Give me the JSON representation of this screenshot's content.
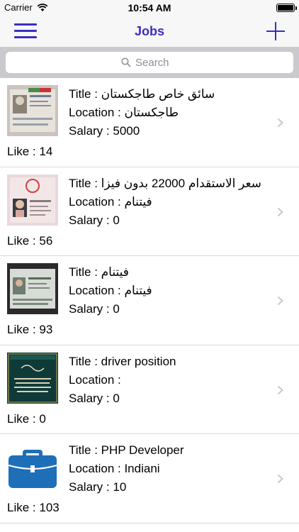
{
  "status": {
    "carrier": "Carrier",
    "time": "10:54 AM"
  },
  "nav": {
    "title": "Jobs"
  },
  "search": {
    "placeholder": "Search"
  },
  "labels": {
    "title_prefix": "Title : ",
    "location_prefix": "Location : ",
    "salary_prefix": "Salary : ",
    "like_prefix": "Like : "
  },
  "jobs": [
    {
      "title": "سائق خاص طاجكستان",
      "location": "طاجكستان",
      "salary": "5000",
      "likes": "14",
      "thumb": "passport-photo-1"
    },
    {
      "title": "سعر الاستقدام 22000 بدون فيزا",
      "location": "فيتنام",
      "salary": "0",
      "likes": "56",
      "thumb": "passport-photo-2"
    },
    {
      "title": "فيتنام",
      "location": "فيتنام",
      "salary": "0",
      "likes": "93",
      "thumb": "passport-photo-3"
    },
    {
      "title": "driver position",
      "location": "",
      "salary": "0",
      "likes": "0",
      "thumb": "arabic-calligraphy-card"
    },
    {
      "title": "PHP Developer",
      "location": "Indiani",
      "salary": "10",
      "likes": "103",
      "thumb": "briefcase-icon"
    }
  ],
  "colors": {
    "accent": "#3a2ec3",
    "bar_background": "#f7f7f8",
    "search_background": "#c9c9ce"
  }
}
